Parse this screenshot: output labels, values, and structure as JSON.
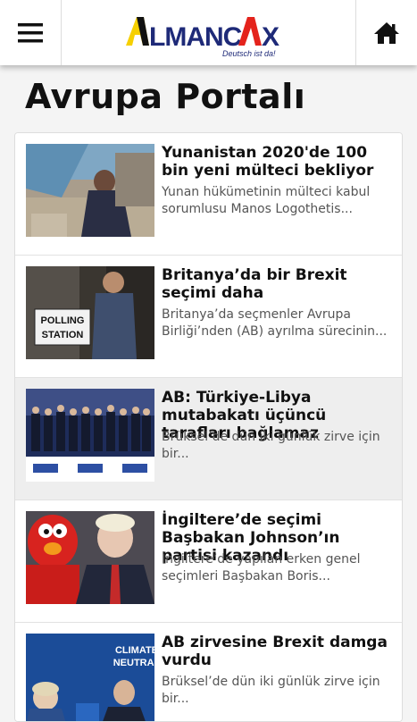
{
  "header": {
    "menu_icon": "hamburger-menu-icon",
    "logo_text": "ALMANCAX",
    "logo_tagline": "Deutsch ist da!",
    "home_icon": "home-icon"
  },
  "page": {
    "title": "Avrupa Portalı"
  },
  "articles": [
    {
      "title": "Yunanistan 2020'de 100 bin yeni mülteci bekliyor",
      "desc": "Yunan hükümetinin mülteci kabul sorumlusu Manos Logothetis..."
    },
    {
      "title": "Britanya’da bir Brexit seçimi daha",
      "desc": "Britanya’da seçmenler Avrupa Birliği’nden (AB) ayrılma sürecinin..."
    },
    {
      "title": "AB: Türkiye-Libya mutabakatı üçüncü tarafları bağlamaz",
      "desc": "Brüksel’de dün iki günlük zirve için bir..."
    },
    {
      "title": "İngiltere’de seçimi Başbakan Johnson’ın partisi kazandı",
      "desc": "İngiltere’de yapılan erken genel seçimleri Başbakan Boris..."
    },
    {
      "title": "AB zirvesine Brexit damga vurdu",
      "desc": "Brüksel’de dün iki günlük zirve için bir..."
    }
  ],
  "image_text": {
    "polling_station": "POLLING STATION",
    "climate": "CLIMATE",
    "neutral": "NEUTRAL"
  }
}
